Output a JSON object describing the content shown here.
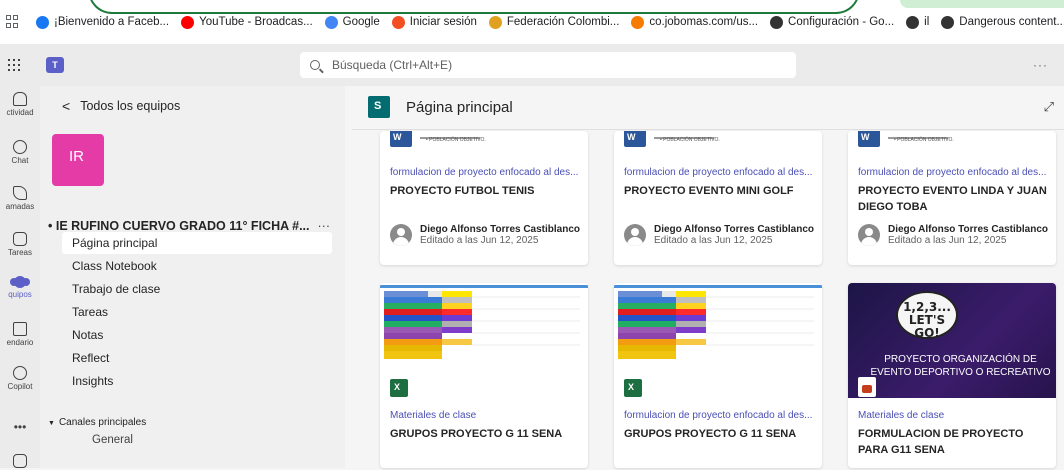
{
  "bookmarks": [
    {
      "label": "¡Bienvenido a Faceb...",
      "icon": "facebook-icon",
      "color": "#1877f2"
    },
    {
      "label": "YouTube - Broadcas...",
      "icon": "youtube-icon",
      "color": "#ff0000"
    },
    {
      "label": "Google",
      "icon": "google-icon",
      "color": "#4285f4"
    },
    {
      "label": "Iniciar sesión",
      "icon": "microsoft-icon",
      "color": "#f25022"
    },
    {
      "label": "Federación Colombi...",
      "icon": "federation-icon",
      "color": "#e0a020"
    },
    {
      "label": "co.jobomas.com/us...",
      "icon": "plus-icon",
      "color": "#f57c00"
    },
    {
      "label": "Configuración - Go...",
      "icon": "settings-globe-icon",
      "color": "#333333"
    },
    {
      "label": "il",
      "icon": "globe-icon",
      "color": "#333333"
    },
    {
      "label": "Dangerous content...",
      "icon": "globe-icon",
      "color": "#333333"
    }
  ],
  "topbar": {
    "search_placeholder": "Búsqueda (Ctrl+Alt+E)",
    "more": "···"
  },
  "rail": [
    {
      "label": "ctividad",
      "icon": "bell-icon"
    },
    {
      "label": "Chat",
      "icon": "chat-icon"
    },
    {
      "label": "amadas",
      "icon": "phone-icon"
    },
    {
      "label": "Tareas",
      "icon": "tasks-icon"
    },
    {
      "label": "quipos",
      "icon": "teams-icon",
      "active": true
    },
    {
      "label": "endario",
      "icon": "calendar-icon"
    },
    {
      "label": "Copilot",
      "icon": "copilot-icon"
    },
    {
      "label": "•••",
      "icon": "more-icon"
    },
    {
      "label": "",
      "icon": "add-apps-icon"
    }
  ],
  "sidebar": {
    "back": "Todos los equipos",
    "avatar": "IR",
    "team_name": "• IE RUFINO CUERVO GRADO 11° FICHA #...",
    "team_more": "···",
    "items": [
      {
        "label": "Página principal",
        "active": true
      },
      {
        "label": "Class Notebook"
      },
      {
        "label": "Trabajo de clase"
      },
      {
        "label": "Tareas"
      },
      {
        "label": "Notas"
      },
      {
        "label": "Reflect"
      },
      {
        "label": "Insights"
      }
    ],
    "channels_header": "Canales principales",
    "channels": [
      "General"
    ]
  },
  "main": {
    "title": "Página principal",
    "cards": [
      {
        "category": "formulacion de proyecto enfocado al des...",
        "title": "PROYECTO FUTBOL TENIS",
        "author": "Diego Alfonso Torres Castiblanco",
        "edited": "Editado a las Jun 12, 2025",
        "thumb_text": "• POBLACIÓN OBJETIVO."
      },
      {
        "category": "formulacion de proyecto enfocado al des...",
        "title": "PROYECTO EVENTO MINI GOLF",
        "author": "Diego Alfonso Torres Castiblanco",
        "edited": "Editado a las Jun 12, 2025",
        "thumb_text": "• POBLACIÓN OBJETIVO."
      },
      {
        "category": "formulacion de proyecto enfocado al des...",
        "title": "PROYECTO EVENTO LINDA Y JUAN DIEGO TOBA",
        "author": "Diego Alfonso Torres Castiblanco",
        "edited": "Editado a las Jun 12, 2025",
        "thumb_text": "• POBLACIÓN OBJETIVO."
      },
      {
        "category": "Materiales de clase",
        "title": "GRUPOS PROYECTO G 11 SENA"
      },
      {
        "category": "formulacion de proyecto enfocado al des...",
        "title": "GRUPOS PROYECTO G 11 SENA"
      },
      {
        "category": "Materiales de clase",
        "title": "FORMULACION DE PROYECTO PARA G11 SENA",
        "thumb_bubble": "1,2,3... LET'S GO!",
        "thumb_text": "PROYECTO ORGANIZACIÓN DE EVENTO DEPORTIVO O RECREATIVO"
      }
    ]
  }
}
